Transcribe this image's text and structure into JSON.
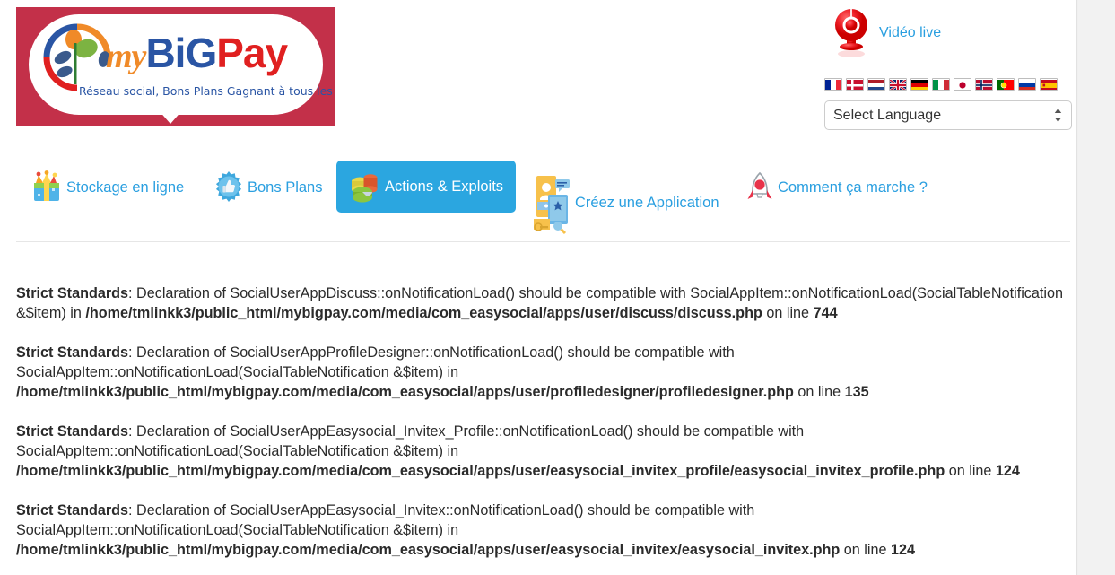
{
  "site": {
    "logo": {
      "brand_my": "my",
      "brand_bi": "B",
      "brand_i": "i",
      "brand_g": "G",
      "brand_p": "P",
      "brand_ay": "ay",
      "tagline": "Réseau social, Bons Plans Gagnant à tous les coups !",
      "bg_color": "#c33049"
    }
  },
  "header": {
    "video_live": {
      "label": "Vidéo live",
      "icon": "webcam-icon",
      "color": "#e02020"
    },
    "flags": [
      {
        "name": "flag-france",
        "code": "fr"
      },
      {
        "name": "flag-denmark",
        "code": "dk"
      },
      {
        "name": "flag-netherlands",
        "code": "nl"
      },
      {
        "name": "flag-united-kingdom",
        "code": "gb"
      },
      {
        "name": "flag-germany",
        "code": "de"
      },
      {
        "name": "flag-italy",
        "code": "it"
      },
      {
        "name": "flag-japan",
        "code": "jp"
      },
      {
        "name": "flag-norway",
        "code": "no"
      },
      {
        "name": "flag-portugal",
        "code": "pt"
      },
      {
        "name": "flag-russia",
        "code": "ru"
      },
      {
        "name": "flag-spain",
        "code": "es"
      }
    ],
    "language_select": {
      "selected": "Select Language",
      "options": [
        "Select Language"
      ]
    }
  },
  "nav": {
    "active_color": "#2ba6e0",
    "link_color": "#2a9fe0",
    "items": [
      {
        "label": "Stockage en ligne",
        "icon": "gift-box-icon",
        "active": false
      },
      {
        "label": "Bons Plans",
        "icon": "thumbs-up-icon",
        "active": false
      },
      {
        "label": "Actions & Exploits",
        "icon": "pie-chart-3d-icon",
        "active": true
      },
      {
        "label": "Créez une Application",
        "icon": "mobile-app-icon",
        "active": false
      },
      {
        "label": "Comment ça marche ?",
        "icon": "rocket-icon",
        "active": false
      }
    ]
  },
  "errors": [
    {
      "prefix": "Strict Standards",
      "message": ": Declaration of SocialUserAppDiscuss::onNotificationLoad() should be compatible with SocialAppItem::onNotificationLoad(SocialTableNotification &$item) in ",
      "path": "/home/tmlinkk3/public_html/mybigpay.com/media/com_easysocial/apps/user/discuss/discuss.php",
      "on_line_text": " on line ",
      "line": "744"
    },
    {
      "prefix": "Strict Standards",
      "message": ": Declaration of SocialUserAppProfileDesigner::onNotificationLoad() should be compatible with SocialAppItem::onNotificationLoad(SocialTableNotification &$item) in ",
      "path": "/home/tmlinkk3/public_html/mybigpay.com/media/com_easysocial/apps/user/profiledesigner/profiledesigner.php",
      "on_line_text": " on line ",
      "line": "135"
    },
    {
      "prefix": "Strict Standards",
      "message": ": Declaration of SocialUserAppEasysocial_Invitex_Profile::onNotificationLoad() should be compatible with SocialAppItem::onNotificationLoad(SocialTableNotification &$item) in ",
      "path": "/home/tmlinkk3/public_html/mybigpay.com/media/com_easysocial/apps/user/easysocial_invitex_profile/easysocial_invitex_profile.php",
      "on_line_text": " on line ",
      "line": "124"
    },
    {
      "prefix": "Strict Standards",
      "message": ": Declaration of SocialUserAppEasysocial_Invitex::onNotificationLoad() should be compatible with SocialAppItem::onNotificationLoad(SocialTableNotification &$item) in ",
      "path": "/home/tmlinkk3/public_html/mybigpay.com/media/com_easysocial/apps/user/easysocial_invitex/easysocial_invitex.php",
      "on_line_text": " on line ",
      "line": "124"
    }
  ]
}
